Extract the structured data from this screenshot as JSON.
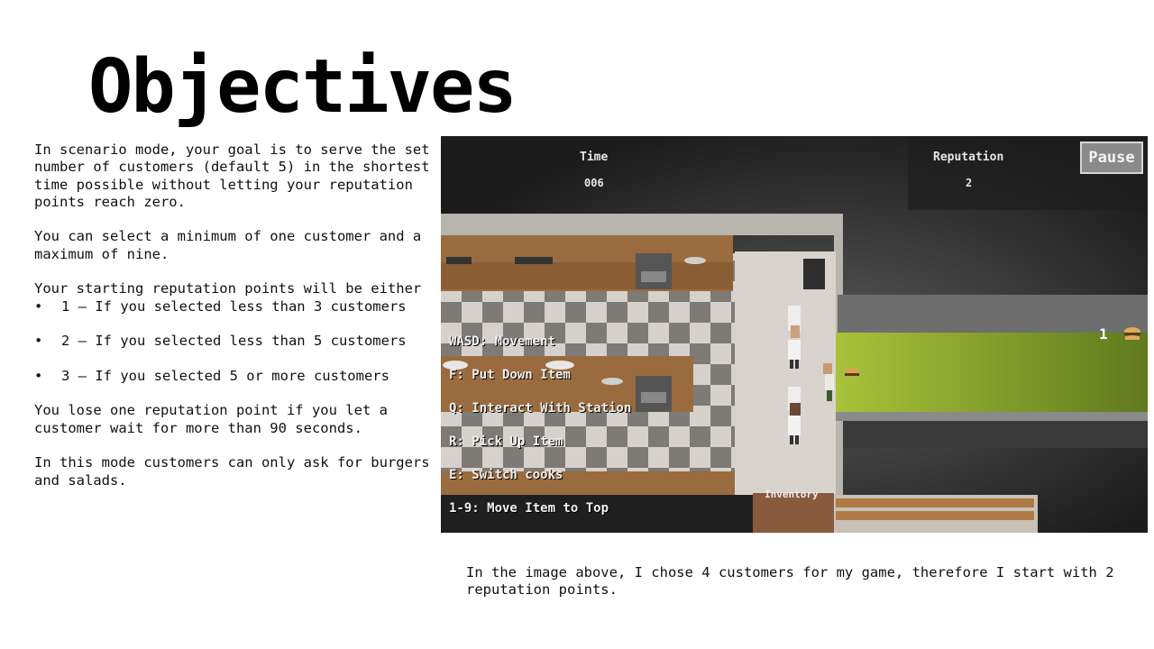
{
  "title": "Objectives",
  "paragraphs": {
    "goal": "In scenario mode, your goal is to serve the set number of customers (default 5) in the shortest time possible without letting your reputation points reach zero.",
    "select": "You can select a minimum of one customer and a maximum of nine.",
    "starting": "Your starting reputation points will be either",
    "lose": "You lose one reputation point if you let a customer wait for more than 90 seconds.",
    "mode": "In this mode customers can only ask for burgers and salads."
  },
  "bullets": [
    "1 – If you selected less than 3 customers",
    "2 – If you selected less than 5 customers",
    "3 – If you selected 5 or more customers"
  ],
  "caption": "In the image above, I chose 4 customers for my game, therefore I start with 2 reputation points.",
  "game": {
    "time_label": "Time",
    "time_value": "006",
    "reputation_label": "Reputation",
    "reputation_value": "2",
    "pause_label": "Pause",
    "inventory_label": "Inventory",
    "counter_value": "1",
    "counter_icon": "burger-icon",
    "key_hints": [
      "WASD: Movement",
      "F: Put Down Item",
      "Q: Interact With Station",
      "R: Pick Up Item",
      "E: Switch cooks",
      "1-9: Move Item to Top"
    ],
    "colors": {
      "grass": "#8fae2c",
      "counter": "#9a6b3e",
      "floor_light": "#d9d4cc",
      "floor_dark": "#8a8580",
      "background": "#2a2a2a"
    }
  }
}
